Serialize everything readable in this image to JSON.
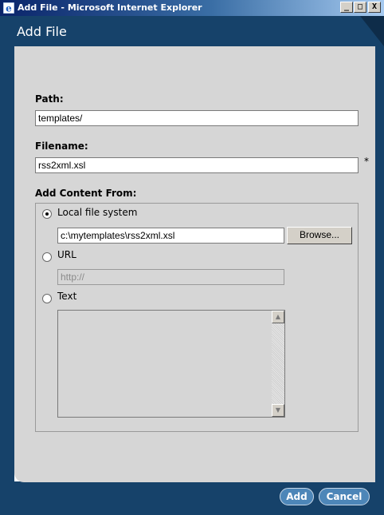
{
  "window": {
    "title": "Add File - Microsoft Internet Explorer",
    "min": "_",
    "max": "□",
    "close": "X"
  },
  "dialog": {
    "title": "Add File"
  },
  "form": {
    "path_label": "Path:",
    "path_value": "templates/",
    "filename_label": "Filename:",
    "filename_value": "rss2xml.xsl",
    "required_marker": "*",
    "add_content_label": "Add Content From:"
  },
  "content_source": {
    "selected": "local",
    "local": {
      "label": "Local file system",
      "value": "c:\\mytemplates\\rss2xml.xsl",
      "browse_label": "Browse..."
    },
    "url": {
      "label": "URL",
      "value": "http://"
    },
    "text": {
      "label": "Text",
      "value": ""
    }
  },
  "footer": {
    "add_label": "Add",
    "cancel_label": "Cancel"
  },
  "colors": {
    "frame": "#16426a",
    "content_bg": "#d6d6d6",
    "button": "#4d86b8"
  }
}
